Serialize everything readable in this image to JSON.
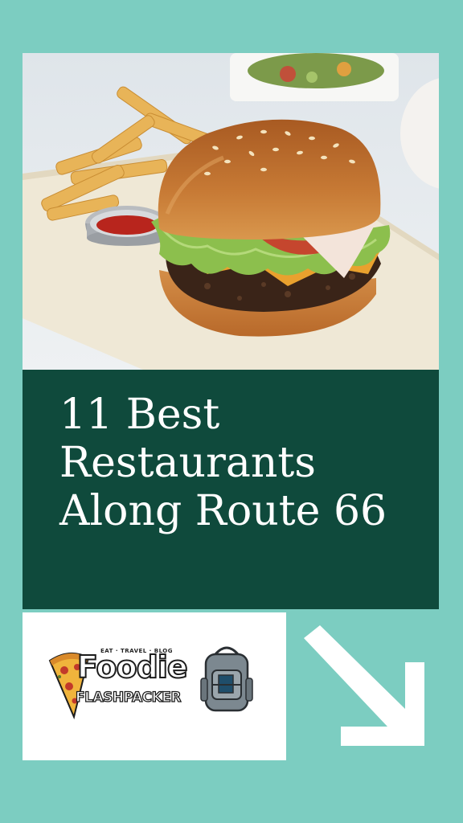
{
  "title": "11 Best Restaurants Along Route 66",
  "hero_image": {
    "subject": "cheeseburger-with-fries-photo"
  },
  "logo": {
    "tagline": "EAT · TRAVEL · BLOG",
    "name_line1": "Foodie",
    "name_line2": "FLASHPACKER"
  },
  "arrow_icon": "arrow-down-right-icon",
  "colors": {
    "background": "#7ccdc1",
    "title_box": "#0f4a3c",
    "title_text": "#ffffff"
  }
}
